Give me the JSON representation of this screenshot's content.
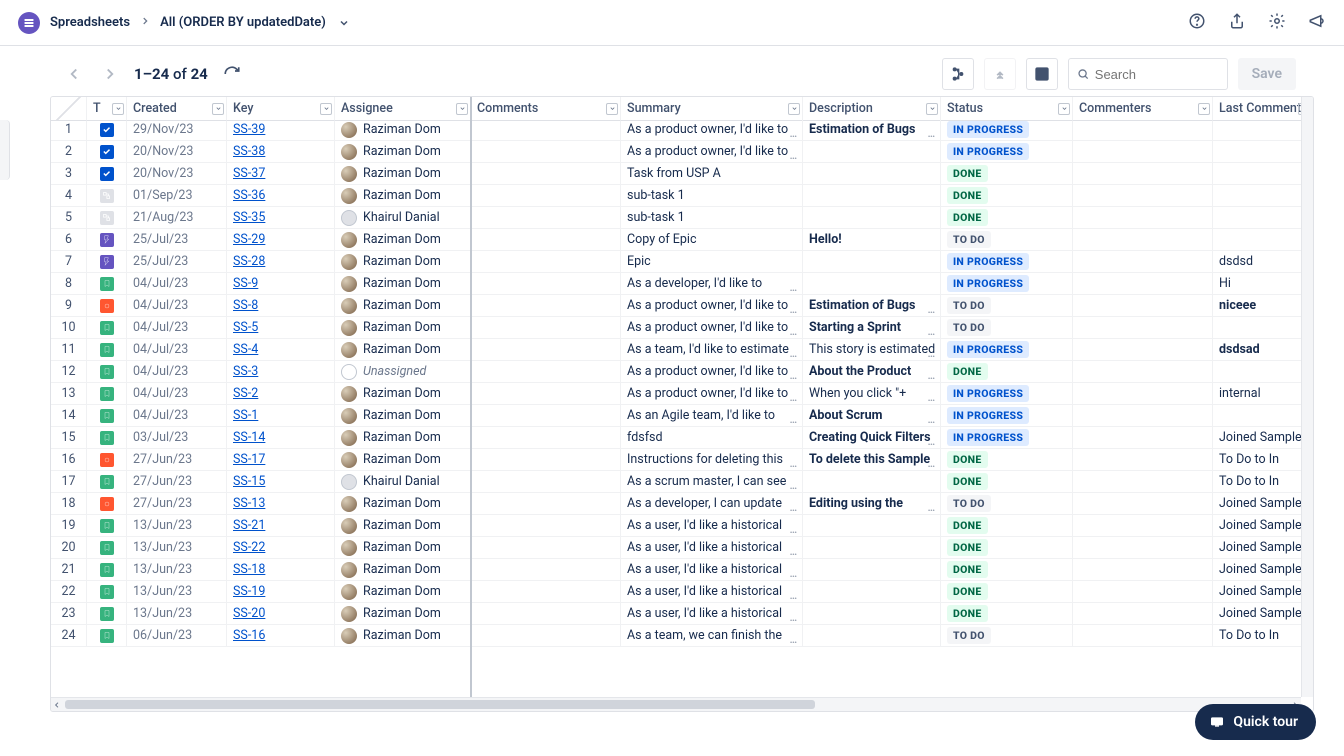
{
  "breadcrumb": {
    "module": "Spreadsheets",
    "view": "All (ORDER BY updatedDate)"
  },
  "pager": {
    "range": "1–24",
    "of": "of",
    "total": "24"
  },
  "search": {
    "placeholder": "Search"
  },
  "save_label": "Save",
  "quicktour_label": "Quick tour",
  "columns": {
    "type": "T",
    "created": "Created",
    "key": "Key",
    "assignee": "Assignee",
    "comments": "Comments",
    "summary": "Summary",
    "description": "Description",
    "status": "Status",
    "commenters": "Commenters",
    "last_comment": "Last Comment"
  },
  "status_labels": {
    "progress": "IN PROGRESS",
    "done": "DONE",
    "todo": "TO DO"
  },
  "rows": [
    {
      "n": "1",
      "type": "task",
      "created": "29/Nov/23",
      "key": "SS-39",
      "assignee": "Raziman Dom",
      "av": "r",
      "summary": "As a product owner, I'd like to",
      "smore": true,
      "descr": "Estimation of Bugs",
      "dbold": true,
      "dmore": true,
      "status": "progress",
      "lastc": ""
    },
    {
      "n": "2",
      "type": "task",
      "created": "20/Nov/23",
      "key": "SS-38",
      "assignee": "Raziman Dom",
      "av": "r",
      "summary": "As a product owner, I'd like to",
      "smore": true,
      "descr": "",
      "status": "progress",
      "lastc": ""
    },
    {
      "n": "3",
      "type": "task",
      "created": "20/Nov/23",
      "key": "SS-37",
      "assignee": "Raziman Dom",
      "av": "r",
      "summary": "Task from USP A",
      "descr": "",
      "status": "done",
      "lastc": ""
    },
    {
      "n": "4",
      "type": "sub",
      "created": "01/Sep/23",
      "key": "SS-36",
      "assignee": "Raziman Dom",
      "av": "r",
      "summary": "sub-task 1",
      "descr": "",
      "status": "done",
      "lastc": ""
    },
    {
      "n": "5",
      "type": "sub",
      "created": "21/Aug/23",
      "key": "SS-35",
      "assignee": "Khairul Danial",
      "av": "k",
      "summary": "sub-task 1",
      "descr": "",
      "status": "done",
      "lastc": ""
    },
    {
      "n": "6",
      "type": "epic",
      "created": "25/Jul/23",
      "key": "SS-29",
      "assignee": "Raziman Dom",
      "av": "r",
      "summary": "Copy of Epic",
      "descr": "Hello!",
      "dbold": true,
      "status": "todo",
      "lastc": ""
    },
    {
      "n": "7",
      "type": "epic",
      "created": "25/Jul/23",
      "key": "SS-28",
      "assignee": "Raziman Dom",
      "av": "r",
      "summary": "Epic",
      "descr": "",
      "status": "progress",
      "lastc": "dsdsd"
    },
    {
      "n": "8",
      "type": "story",
      "created": "04/Jul/23",
      "key": "SS-9",
      "assignee": "Raziman Dom",
      "av": "r",
      "summary": "As a developer, I'd like to",
      "smore": true,
      "descr": "",
      "status": "progress",
      "lastc": "Hi"
    },
    {
      "n": "9",
      "type": "bug",
      "created": "04/Jul/23",
      "key": "SS-8",
      "assignee": "Raziman Dom",
      "av": "r",
      "summary": "As a product owner, I'd like to",
      "smore": true,
      "descr": "Estimation of Bugs",
      "dbold": true,
      "dmore": true,
      "status": "todo",
      "lastc": "niceee",
      "lbold": true
    },
    {
      "n": "10",
      "type": "story",
      "created": "04/Jul/23",
      "key": "SS-5",
      "assignee": "Raziman Dom",
      "av": "r",
      "summary": "As a product owner, I'd like to",
      "smore": true,
      "descr": "Starting a Sprint",
      "dbold": true,
      "dmore": true,
      "status": "todo",
      "lastc": ""
    },
    {
      "n": "11",
      "type": "story",
      "created": "04/Jul/23",
      "key": "SS-4",
      "assignee": "Raziman Dom",
      "av": "r",
      "summary": "As a team, I'd like to estimate",
      "smore": true,
      "descr": "This story is estimated",
      "dmore": true,
      "status": "progress",
      "lastc": "dsdsad",
      "lbold": true
    },
    {
      "n": "12",
      "type": "story",
      "created": "04/Jul/23",
      "key": "SS-3",
      "assignee": "Unassigned",
      "av": "u",
      "summary": "As a product owner, I'd like to",
      "smore": true,
      "descr": "About the Product",
      "dbold": true,
      "dmore": true,
      "status": "done",
      "lastc": ""
    },
    {
      "n": "13",
      "type": "story",
      "created": "04/Jul/23",
      "key": "SS-2",
      "assignee": "Raziman Dom",
      "av": "r",
      "summary": "As a product owner, I'd like to",
      "smore": true,
      "descr": "When you click \"+",
      "dmore": true,
      "status": "progress",
      "lastc": "internal"
    },
    {
      "n": "14",
      "type": "story",
      "created": "04/Jul/23",
      "key": "SS-1",
      "assignee": "Raziman Dom",
      "av": "r",
      "summary": "As an Agile team, I'd like to",
      "smore": true,
      "descr": "About Scrum",
      "dbold": true,
      "dmore": true,
      "status": "progress",
      "lastc": ""
    },
    {
      "n": "15",
      "type": "story",
      "created": "03/Jul/23",
      "key": "SS-14",
      "assignee": "Raziman Dom",
      "av": "r",
      "summary": "fdsfsd",
      "descr": "Creating Quick Filters",
      "dbold": true,
      "dmore": true,
      "status": "progress",
      "lastc": "Joined Sample"
    },
    {
      "n": "16",
      "type": "bug",
      "created": "27/Jun/23",
      "key": "SS-17",
      "assignee": "Raziman Dom",
      "av": "r",
      "summary": "Instructions for deleting this",
      "smore": true,
      "descr": "To delete this Sample",
      "dbold": true,
      "dmore": true,
      "status": "done",
      "lastc": "To Do to In"
    },
    {
      "n": "17",
      "type": "story",
      "created": "27/Jun/23",
      "key": "SS-15",
      "assignee": "Khairul Danial",
      "av": "k",
      "summary": "As a scrum master, I can see",
      "smore": true,
      "descr": "",
      "status": "done",
      "lastc": "To Do to In"
    },
    {
      "n": "18",
      "type": "bug",
      "created": "27/Jun/23",
      "key": "SS-13",
      "assignee": "Raziman Dom",
      "av": "r",
      "summary": "As a developer, I can update",
      "smore": true,
      "descr": "Editing using the",
      "dbold": true,
      "dmore": true,
      "status": "todo",
      "lastc": "Joined Sample"
    },
    {
      "n": "19",
      "type": "story",
      "created": "13/Jun/23",
      "key": "SS-21",
      "assignee": "Raziman Dom",
      "av": "r",
      "summary": "As a user, I'd like a historical",
      "smore": true,
      "descr": "",
      "status": "done",
      "lastc": "Joined Sample"
    },
    {
      "n": "20",
      "type": "story",
      "created": "13/Jun/23",
      "key": "SS-22",
      "assignee": "Raziman Dom",
      "av": "r",
      "summary": "As a user, I'd like a historical",
      "smore": true,
      "descr": "",
      "status": "done",
      "lastc": "Joined Sample"
    },
    {
      "n": "21",
      "type": "story",
      "created": "13/Jun/23",
      "key": "SS-18",
      "assignee": "Raziman Dom",
      "av": "r",
      "summary": "As a user, I'd like a historical",
      "smore": true,
      "descr": "",
      "status": "done",
      "lastc": "Joined Sample"
    },
    {
      "n": "22",
      "type": "story",
      "created": "13/Jun/23",
      "key": "SS-19",
      "assignee": "Raziman Dom",
      "av": "r",
      "summary": "As a user, I'd like a historical",
      "smore": true,
      "descr": "",
      "status": "done",
      "lastc": "Joined Sample"
    },
    {
      "n": "23",
      "type": "story",
      "created": "13/Jun/23",
      "key": "SS-20",
      "assignee": "Raziman Dom",
      "av": "r",
      "summary": "As a user, I'd like a historical",
      "smore": true,
      "descr": "",
      "status": "done",
      "lastc": "Joined Sample"
    },
    {
      "n": "24",
      "type": "story",
      "created": "06/Jun/23",
      "key": "SS-16",
      "assignee": "Raziman Dom",
      "av": "r",
      "summary": "As a team, we can finish the",
      "smore": true,
      "descr": "",
      "status": "todo",
      "lastc": "To Do to In"
    }
  ]
}
